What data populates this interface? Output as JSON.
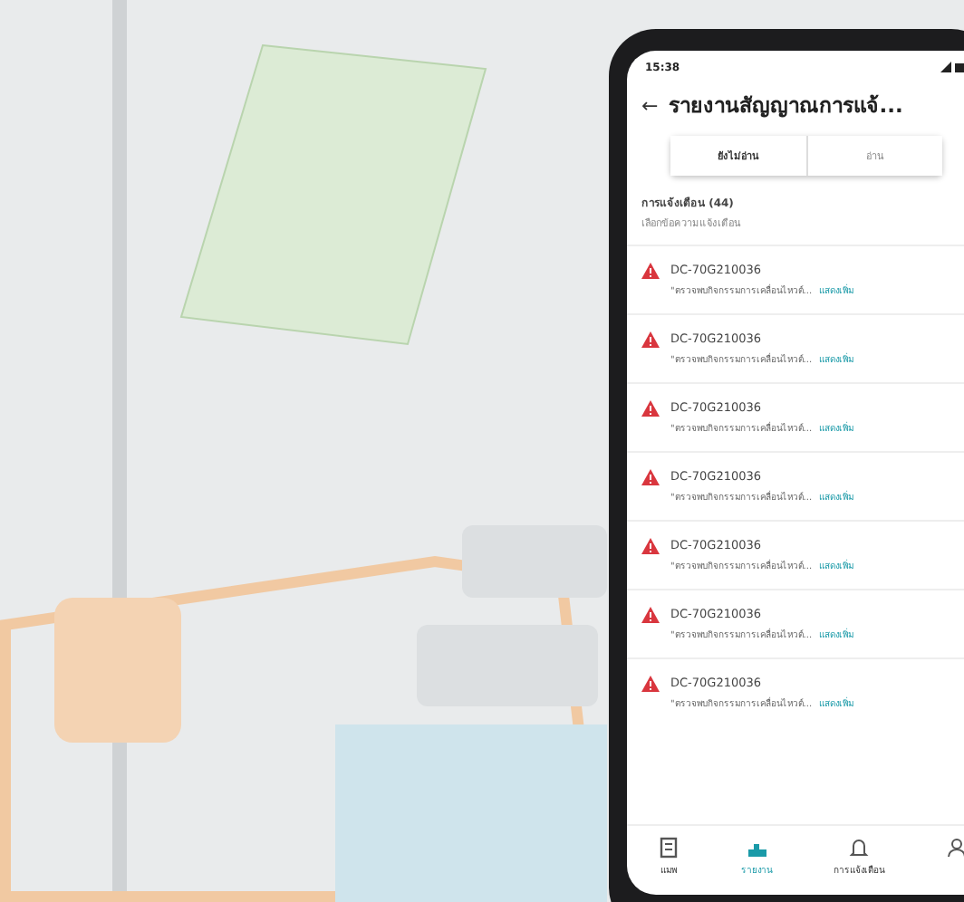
{
  "status_bar": {
    "time": "15:38"
  },
  "header": {
    "back": "←",
    "title": "รายงานสัญญาณการแจ้..."
  },
  "tabs": [
    {
      "label": "ยังไม่อ่าน",
      "selected": true
    },
    {
      "label": "อ่าน",
      "selected": false
    }
  ],
  "summary": {
    "count_label": "การแจ้งเตือน (44)",
    "hint": "เลือกข้อความแจ้งเตือน"
  },
  "alerts": [
    {
      "code": "DC-70G210036",
      "message": "\"ตรวจพบกิจกรรมการเคลื่อนไหวต์...",
      "link": "แสดงเพิ่ม"
    },
    {
      "code": "DC-70G210036",
      "message": "\"ตรวจพบกิจกรรมการเคลื่อนไหวต์...",
      "link": "แสดงเพิ่ม"
    },
    {
      "code": "DC-70G210036",
      "message": "\"ตรวจพบกิจกรรมการเคลื่อนไหวต์...",
      "link": "แสดงเพิ่ม"
    },
    {
      "code": "DC-70G210036",
      "message": "\"ตรวจพบกิจกรรมการเคลื่อนไหวต์...",
      "link": "แสดงเพิ่ม"
    },
    {
      "code": "DC-70G210036",
      "message": "\"ตรวจพบกิจกรรมการเคลื่อนไหวต์...",
      "link": "แสดงเพิ่ม"
    },
    {
      "code": "DC-70G210036",
      "message": "\"ตรวจพบกิจกรรมการเคลื่อนไหวต์...",
      "link": "แสดงเพิ่ม"
    },
    {
      "code": "DC-70G210036",
      "message": "\"ตรวจพบกิจกรรมการเคลื่อนไหวต์...",
      "link": "แสดงเพิ่ม"
    }
  ],
  "bottom_nav": [
    {
      "kind": "map",
      "label": "แมพ",
      "selected": false
    },
    {
      "kind": "report",
      "label": "รายงาน",
      "selected": true
    },
    {
      "kind": "bell",
      "label": "การแจ้งเตือน",
      "selected": false
    },
    {
      "kind": "person",
      "selected": false
    }
  ]
}
